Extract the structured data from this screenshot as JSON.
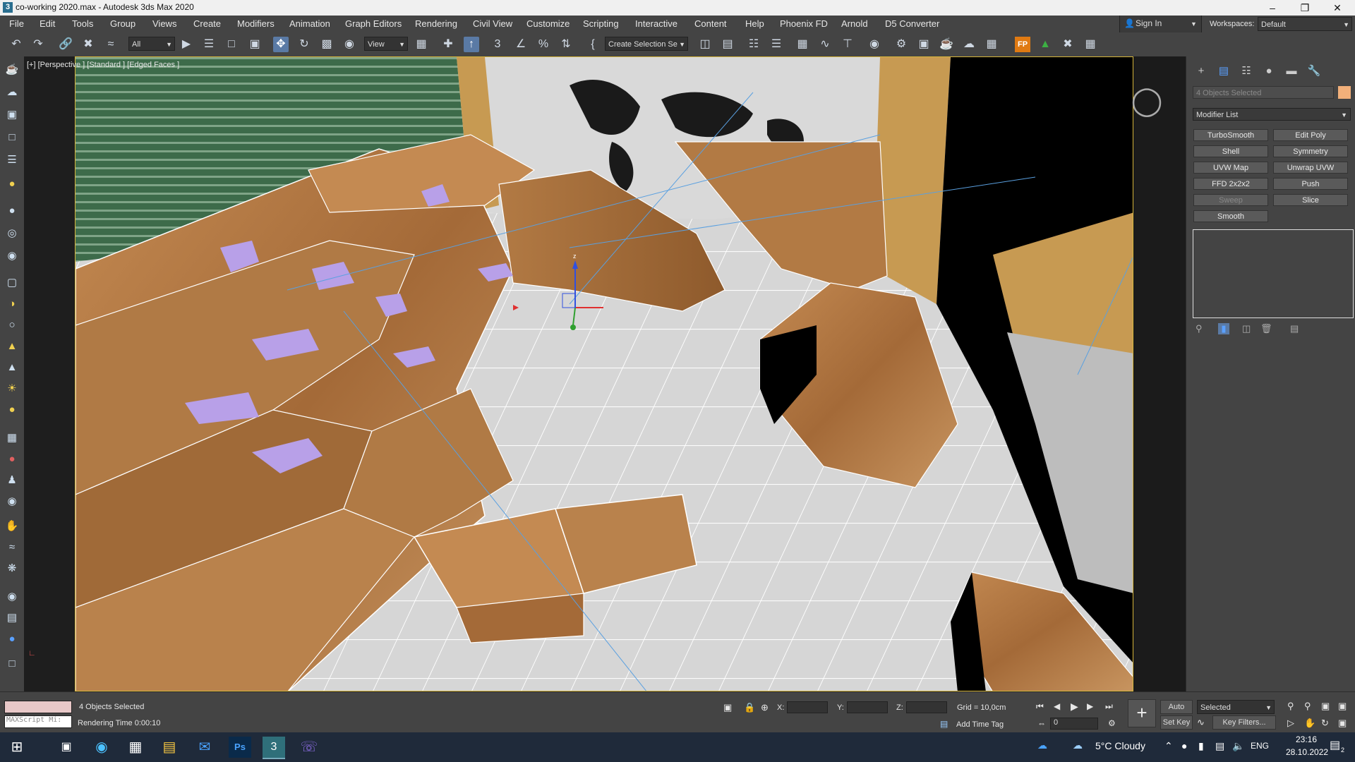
{
  "window": {
    "title": "co-working 2020.max - Autodesk 3ds Max 2020",
    "app_icon_letter": "3"
  },
  "menu": {
    "items": [
      "File",
      "Edit",
      "Tools",
      "Group",
      "Views",
      "Create",
      "Modifiers",
      "Animation",
      "Graph Editors",
      "Rendering",
      "Civil View",
      "Customize",
      "Scripting",
      "Interactive",
      "Content",
      "Help",
      "Phoenix FD",
      "Arnold",
      "D5 Converter"
    ],
    "sign_in": "Sign In",
    "workspaces_label": "Workspaces:",
    "workspaces_value": "Default"
  },
  "toolbar": {
    "selection_filter": "All",
    "ref_coord": "View",
    "named_selection": "Create Selection Se"
  },
  "viewport": {
    "label": "[+] [Perspective ] [Standard ] [Edged Faces ]"
  },
  "command_panel": {
    "selection_label": "4 Objects Selected",
    "modifier_list": "Modifier List",
    "modifier_buttons": [
      {
        "label": "TurboSmooth",
        "enabled": true
      },
      {
        "label": "Edit Poly",
        "enabled": true
      },
      {
        "label": "Shell",
        "enabled": true
      },
      {
        "label": "Symmetry",
        "enabled": true
      },
      {
        "label": "UVW Map",
        "enabled": true
      },
      {
        "label": "Unwrap UVW",
        "enabled": true
      },
      {
        "label": "FFD 2x2x2",
        "enabled": true
      },
      {
        "label": "Push",
        "enabled": true
      },
      {
        "label": "Sweep",
        "enabled": false
      },
      {
        "label": "Slice",
        "enabled": true
      },
      {
        "label": "Smooth",
        "enabled": true
      }
    ],
    "object_color": "#f2b07a"
  },
  "status": {
    "maxscript_placeholder": "MAXScript Mi:",
    "selected": "4 Objects Selected",
    "rendering_time": "Rendering Time  0:00:10",
    "x_label": "X:",
    "y_label": "Y:",
    "z_label": "Z:",
    "grid": "Grid = 10,0cm",
    "add_time_tag": "Add Time Tag",
    "frame": "0",
    "auto_key": "Auto Key",
    "set_key": "Set Key",
    "key_mode": "Selected",
    "key_filters": "Key Filters..."
  },
  "taskbar": {
    "weather": "5°C  Cloudy",
    "language": "ENG",
    "time": "23:16",
    "date": "28.10.2022",
    "notifications": "2"
  },
  "colors": {
    "wood": "#b07a45",
    "floor": "#d4d4d4",
    "seat": "#b8a0e8",
    "wall": "#c79a52"
  }
}
